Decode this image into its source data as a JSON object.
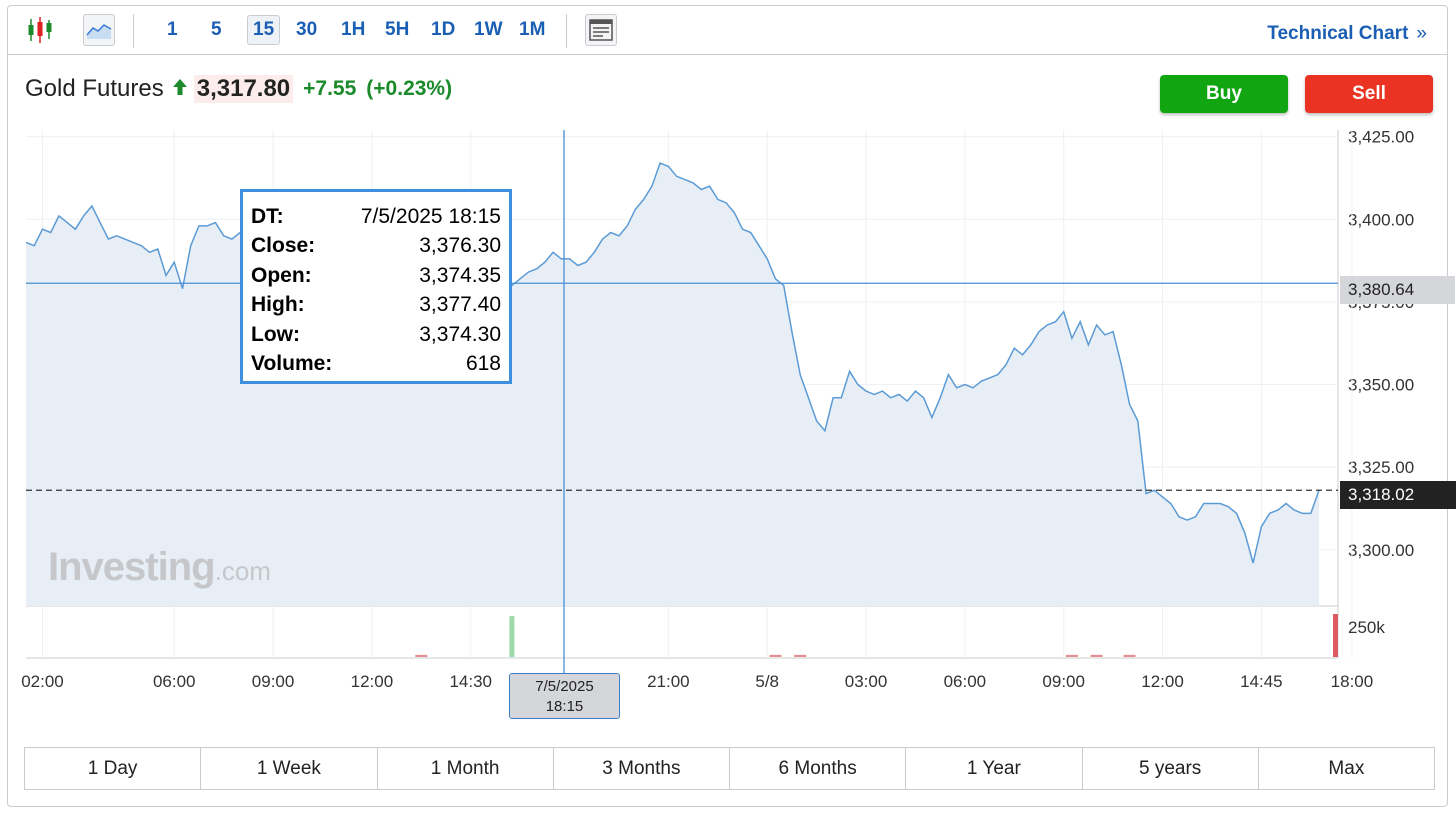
{
  "toolbar": {
    "candle_icon": "candlestick-icon",
    "area_icon": "area-chart-icon",
    "intervals": [
      "1",
      "5",
      "15",
      "30",
      "1H",
      "5H",
      "1D",
      "1W",
      "1M"
    ],
    "active_interval": "15",
    "layout_icon": "layout-icon",
    "technical_chart_label": "Technical Chart",
    "technical_chart_arrow": "»"
  },
  "instrument": {
    "name": "Gold Futures",
    "price": "3,317.80",
    "change": "+7.55",
    "change_percent": "(+0.23%)",
    "up_color": "#1a8a2a"
  },
  "actions": {
    "buy_label": "Buy",
    "sell_label": "Sell",
    "buy_color": "#12a512",
    "sell_color": "#ea3323"
  },
  "tooltip": {
    "rows": [
      {
        "key": "DT:",
        "value": "7/5/2025 18:15"
      },
      {
        "key": "Close:",
        "value": "3,376.30"
      },
      {
        "key": "Open:",
        "value": "3,374.35"
      },
      {
        "key": "High:",
        "value": "3,377.40"
      },
      {
        "key": "Low:",
        "value": "3,374.30"
      },
      {
        "key": "Volume:",
        "value": "618"
      }
    ]
  },
  "crosshair": {
    "x_label_line1": "7/5/2025",
    "x_label_line2": "18:15",
    "y_label": "3,380.64",
    "y_value": 3380.64
  },
  "last_price_label": "3,318.02",
  "last_price_value": 3318.02,
  "watermark": {
    "brand": "Investing",
    "suffix": ".com"
  },
  "chart_data": {
    "type": "area",
    "y_ticks": [
      "3,425.00",
      "3,400.00",
      "3,375.00",
      "3,350.00",
      "3,325.00",
      "3,300.00"
    ],
    "y_tick_values": [
      3425,
      3400,
      3375,
      3350,
      3325,
      3300
    ],
    "ylim": [
      3283,
      3427
    ],
    "volume_tick": "250k",
    "x_ticks": [
      "02:00",
      "06:00",
      "09:00",
      "12:00",
      "14:30",
      "21:00",
      "5/8",
      "03:00",
      "06:00",
      "09:00",
      "12:00",
      "14:45",
      "18:00"
    ],
    "x_tick_index": [
      2,
      18,
      30,
      42,
      54,
      78,
      90,
      102,
      114,
      126,
      138,
      150,
      161
    ],
    "grid": true,
    "series": [
      {
        "values": [
          3393,
          3392,
          3397,
          3396,
          3401,
          3399,
          3397,
          3401,
          3404,
          3399,
          3394,
          3395,
          3394,
          3393,
          3392,
          3390,
          3391,
          3383,
          3387,
          3379,
          3392,
          3398,
          3398,
          3399,
          3395,
          3394,
          3396,
          3397,
          3398,
          3396,
          3393,
          3391,
          3394,
          3400,
          3402,
          3397,
          3395,
          3392,
          3394,
          3393,
          3391,
          3390,
          3392,
          3393,
          3392,
          3394,
          3390,
          3388,
          3385,
          3383,
          3381,
          3379,
          3377,
          3375,
          3376,
          3376,
          3378,
          3379,
          3378,
          3380,
          3382,
          3384,
          3385,
          3387,
          3390,
          3388,
          3388,
          3386,
          3387,
          3390,
          3394,
          3396,
          3395,
          3398,
          3403,
          3406,
          3410,
          3417,
          3416,
          3413,
          3412,
          3411,
          3409,
          3410,
          3406,
          3405,
          3402,
          3397,
          3396,
          3392,
          3388,
          3382,
          3380,
          3366,
          3353,
          3346,
          3339,
          3336,
          3346,
          3346,
          3354,
          3350,
          3348,
          3347,
          3348,
          3346,
          3347,
          3345,
          3348,
          3346,
          3340,
          3346,
          3353,
          3349,
          3350,
          3349,
          3351,
          3352,
          3353,
          3356,
          3361,
          3359,
          3362,
          3366,
          3368,
          3369,
          3372,
          3364,
          3369,
          3362,
          3368,
          3365,
          3366,
          3356,
          3344,
          3339,
          3317,
          3318,
          3316,
          3314,
          3310,
          3309,
          3310,
          3314,
          3314,
          3314,
          3313,
          3311,
          3305,
          3296,
          3307,
          3311,
          3312,
          3314,
          3312,
          3311,
          3311,
          3318
        ]
      }
    ],
    "volume": {
      "bars": [
        {
          "index": 48,
          "color": "#e88d92",
          "value": 5
        },
        {
          "index": 59,
          "color": "#9fd9a9",
          "value": 95
        },
        {
          "index": 91,
          "color": "#e88d92",
          "value": 5
        },
        {
          "index": 94,
          "color": "#e88d92",
          "value": 5
        },
        {
          "index": 127,
          "color": "#e88d92",
          "value": 5
        },
        {
          "index": 130,
          "color": "#e88d92",
          "value": 5
        },
        {
          "index": 134,
          "color": "#e88d92",
          "value": 5
        },
        {
          "index": 159,
          "color": "#dc5a62",
          "value": 100
        }
      ]
    }
  },
  "ranges": [
    "1 Day",
    "1 Week",
    "1 Month",
    "3 Months",
    "6 Months",
    "1 Year",
    "5 years",
    "Max"
  ]
}
